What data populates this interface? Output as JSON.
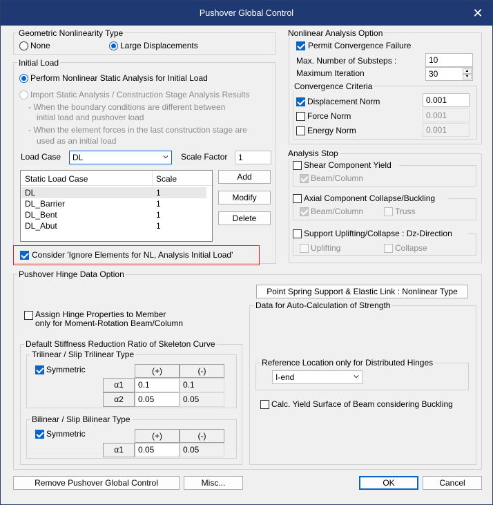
{
  "window": {
    "title": "Pushover Global Control"
  },
  "geometric": {
    "title": "Geometric Nonlinearity Type",
    "none": "None",
    "large": "Large Displacements"
  },
  "initial_load": {
    "title": "Initial Load",
    "perform": "Perform Nonlinear Static Analysis for Initial Load",
    "import": "Import Static Analysis / Construction Stage Analysis Results",
    "note1a": "- When the boundary conditions are different between",
    "note1b": "initial load and pushover load",
    "note2a": "- When the element forces in the last construction stage are",
    "note2b": "used as an initial load",
    "load_case_label": "Load Case",
    "load_case_value": "DL",
    "scale_factor_label": "Scale Factor",
    "scale_factor_value": "1",
    "table": {
      "col_case": "Static Load Case",
      "col_scale": "Scale",
      "rows": [
        {
          "case": "DL",
          "scale": "1"
        },
        {
          "case": "DL_Barrier",
          "scale": "1"
        },
        {
          "case": "DL_Bent",
          "scale": "1"
        },
        {
          "case": "DL_Abut",
          "scale": "1"
        }
      ]
    },
    "add": "Add",
    "modify": "Modify",
    "delete": "Delete",
    "consider": "Consider 'Ignore Elements for NL, Analysis Initial Load'"
  },
  "nonlinear": {
    "title": "Nonlinear Analysis Option",
    "permit": "Permit Convergence Failure",
    "max_substeps_label": "Max. Number of Substeps :",
    "max_substeps_value": "10",
    "max_iter_label": "Maximum Iteration",
    "max_iter_value": "30",
    "criteria_title": "Convergence Criteria",
    "disp_norm": "Displacement Norm",
    "disp_norm_value": "0.001",
    "force_norm": "Force Norm",
    "force_norm_value": "0.001",
    "energy_norm": "Energy Norm",
    "energy_norm_value": "0.001"
  },
  "analysis_stop": {
    "title": "Analysis Stop",
    "shear": "Shear Component Yield",
    "shear_beam": "Beam/Column",
    "axial": "Axial Component Collapse/Buckling",
    "axial_beam": "Beam/Column",
    "axial_truss": "Truss",
    "uplift": "Support Uplifting/Collapse : Dz-Direction",
    "uplifting": "Uplifting",
    "collapse": "Collapse"
  },
  "hinge": {
    "title": "Pushover Hinge Data Option",
    "point_spring": "Point Spring Support & Elastic Link : Nonlinear Type",
    "assign1": "Assign Hinge Properties to Member",
    "assign2": "only for Moment-Rotation Beam/Column",
    "auto_title": "Data for Auto-Calculation of Strength",
    "ref_title": "Reference Location only for Distributed Hinges",
    "ref_value": "I-end",
    "calc": "Calc. Yield Surface of Beam considering Buckling",
    "stiff_title": "Default Stiffness Reduction Ratio of Skeleton Curve",
    "tri_title": "Trilinear / Slip Trilinear Type",
    "tri_sym": "Symmetric",
    "plus": "(+)",
    "minus": "(-)",
    "a1": "α1",
    "a2": "α2",
    "tri_a1_p": "0.1",
    "tri_a1_m": "0.1",
    "tri_a2_p": "0.05",
    "tri_a2_m": "0.05",
    "bi_title": "Bilinear / Slip Bilinear Type",
    "bi_sym": "Symmetric",
    "bi_a1_p": "0.05",
    "bi_a1_m": "0.05"
  },
  "footer": {
    "remove": "Remove Pushover Global Control",
    "misc": "Misc...",
    "ok": "OK",
    "cancel": "Cancel"
  },
  "colors": {
    "titlebar": "#1f3a73",
    "accent": "#0a64c8",
    "highlight": "#e02020"
  }
}
